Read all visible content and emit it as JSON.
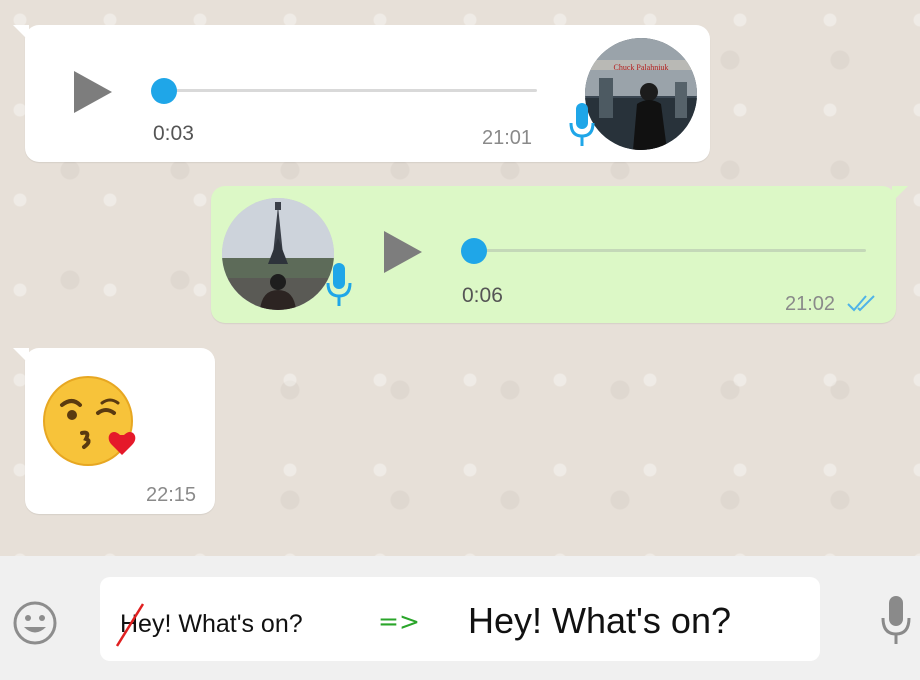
{
  "colors": {
    "incoming_bubble": "#ffffff",
    "outgoing_bubble": "#dcf8c6",
    "accent_blue": "#1fa6e8",
    "arrow_green": "#2aa52a",
    "strike_red": "#e02020"
  },
  "messages": [
    {
      "type": "voice",
      "direction": "incoming",
      "duration": "0:03",
      "time": "21:01",
      "progress": 0,
      "avatar_caption": "Chuck Palahniuk",
      "icons": [
        "play-icon",
        "mic-icon"
      ]
    },
    {
      "type": "voice",
      "direction": "outgoing",
      "duration": "0:06",
      "time": "21:02",
      "progress": 0,
      "status": "read",
      "icons": [
        "play-icon",
        "mic-icon",
        "double-check-icon"
      ]
    },
    {
      "type": "emoji",
      "direction": "incoming",
      "emoji": "kissing-face-with-heart",
      "time": "22:15"
    }
  ],
  "composer": {
    "typed_text": "Hey! What's on?",
    "typed_note": "first letter crossed out",
    "arrow": "=>",
    "corrected_text": "Hey! What's on?",
    "left_icon": "smiley-icon",
    "right_icon": "mic-icon"
  }
}
